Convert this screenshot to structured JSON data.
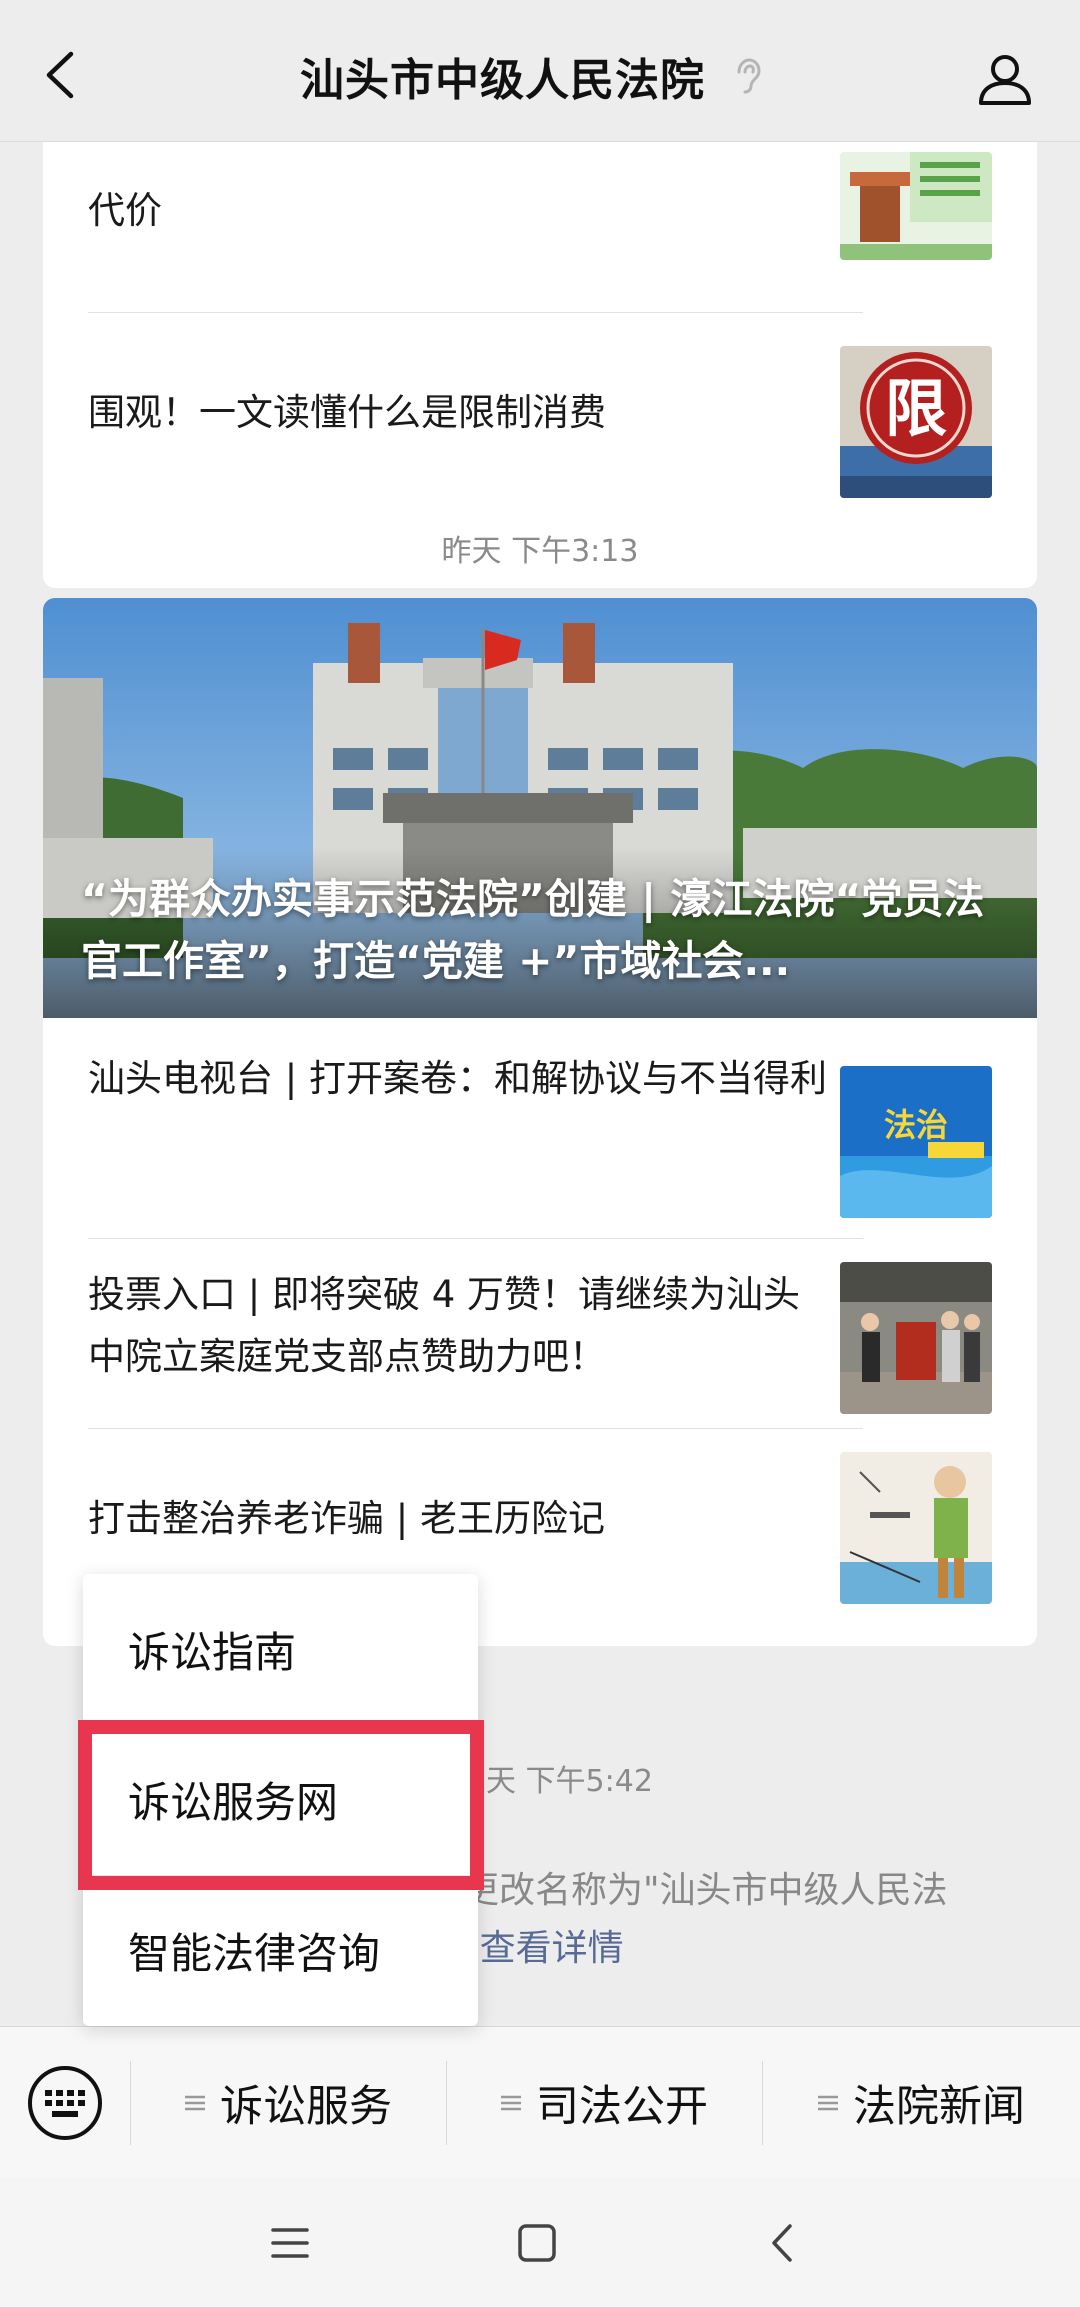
{
  "header": {
    "title": "汕头市中级人民法院"
  },
  "articles_top": [
    {
      "title": "代价"
    },
    {
      "title": "围观！一文读懂什么是限制消费"
    }
  ],
  "group2": {
    "timestamp": "昨天 下午3:13",
    "hero_title": "“为群众办实事示范法院”创建 | 濠江法院“党员法官工作室”，打造“党建 +”市域社会...",
    "items": [
      {
        "title": "汕头电视台 | 打开案卷：和解协议与不当得利"
      },
      {
        "title": "投票入口 | 即将突破 4 万赞！请继续为汕头中院立案庭党支部点赞助力吧！"
      },
      {
        "title": "打击整治养老诈骗 | 老王历险记"
      }
    ]
  },
  "group3": {
    "timestamp_partial": "天 下午5:42",
    "notice_partial": "更改名称为\"汕头市中级人民法",
    "notice_line2": "\"",
    "notice_link": "查看详情"
  },
  "popup": {
    "items": [
      "诉讼指南",
      "诉讼服务网",
      "智能法律咨询"
    ],
    "highlighted": "诉讼服务网"
  },
  "menubar": {
    "tabs": [
      "诉讼服务",
      "司法公开",
      "法院新闻"
    ]
  },
  "colors": {
    "highlight": "#e8364f",
    "link": "#576b95",
    "background": "#ededed"
  }
}
